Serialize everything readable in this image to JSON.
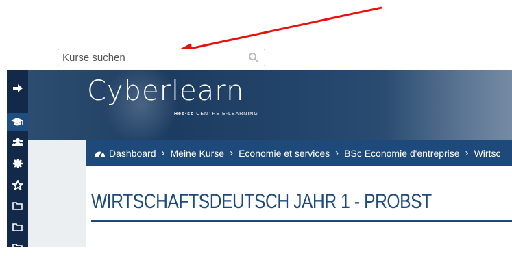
{
  "search": {
    "placeholder": "Kurse suchen"
  },
  "sidebar": {
    "items": [
      {
        "icon": "arrow-right-icon"
      },
      {
        "icon": "graduation-cap-icon",
        "active": true
      },
      {
        "icon": "users-icon"
      },
      {
        "icon": "gear-icon"
      },
      {
        "icon": "star-icon"
      },
      {
        "icon": "folder-icon"
      },
      {
        "icon": "folder-icon"
      },
      {
        "icon": "folder-icon"
      }
    ]
  },
  "banner": {
    "logo_text": "Cyberlearn",
    "logo_sub_brand": "Hes·so",
    "logo_sub_text": "CENTRE E-LEARNING"
  },
  "breadcrumb": [
    "Dashboard",
    "Meine Kurse",
    "Economie et services",
    "BSc Economie d'entreprise",
    "Wirtsc"
  ],
  "page": {
    "title": "WIRTSCHAFTSDEUTSCH JAHR 1 - PROBST"
  },
  "colors": {
    "accent": "#1d4a7a",
    "sidebar": "#13294a",
    "annotation_arrow": "#e3140f"
  }
}
